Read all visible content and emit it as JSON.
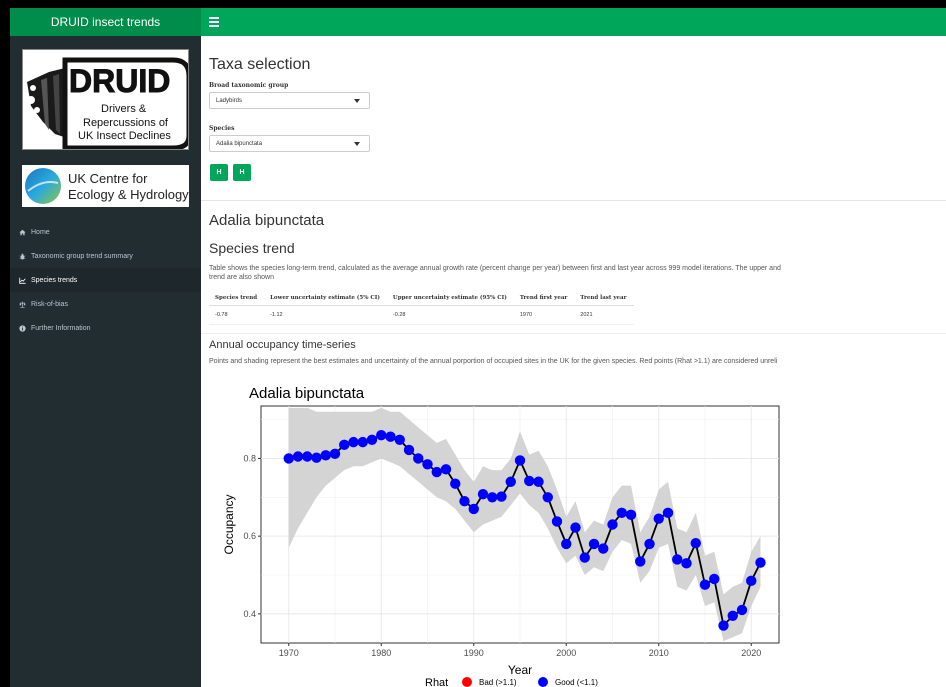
{
  "app": {
    "title": "DRUID insect trends"
  },
  "logos": {
    "druid": {
      "wordmark": "DRUID",
      "line1": "Drivers &",
      "line2": "Repercussions of",
      "line3": "UK Insect Declines"
    },
    "ukceh": {
      "line1": "UK Centre for",
      "line2": "Ecology & Hydrology"
    }
  },
  "sidebar": {
    "items": [
      {
        "label": "Home",
        "icon": "home-icon"
      },
      {
        "label": "Taxonomic group trend summary",
        "icon": "bug-icon"
      },
      {
        "label": "Species trends",
        "icon": "chart-line-icon"
      },
      {
        "label": "Risk-of-bias",
        "icon": "balance-icon"
      },
      {
        "label": "Further Information",
        "icon": "info-circle-icon"
      }
    ]
  },
  "taxa": {
    "heading": "Taxa selection",
    "group_label": "Broad taxonomic group",
    "group_value": "Ladybirds",
    "species_label": "Species",
    "species_value": "Adalia bipunctata",
    "prev_label": "H",
    "next_label": "H"
  },
  "species": {
    "title": "Adalia bipunctata",
    "trend_heading": "Species trend",
    "trend_desc_1": "Table shows the species long-term trend, calculated as the average annual growth rate (percent change per year) between first and last year across 999 model iterations. The upper and",
    "trend_desc_2": "trend are also shown",
    "table": {
      "headers": [
        "Species trend",
        "Lower uncertainty estimate (5% CI)",
        "Upper uncertainty estimate (95% CI)",
        "Trend first year",
        "Trend last year"
      ],
      "row": [
        "-0.78",
        "-1.12",
        "-0.28",
        "1970",
        "2021"
      ]
    },
    "annual_heading": "Annual occupancy time-series",
    "annual_desc": "Points and shading represent the best estimates and uncertainty of the annual porportion of occupied sites in the UK for the given species. Red points (Rhat >1.1) are considered unreli"
  },
  "chart_data": {
    "type": "line",
    "title": "Adalia bipunctata",
    "xlabel": "Year",
    "ylabel": "Occupancy",
    "xlim": [
      1967,
      2023
    ],
    "ylim": [
      0.325,
      0.935
    ],
    "xticks": [
      1970,
      1980,
      1990,
      2000,
      2010,
      2020
    ],
    "yticks": [
      0.4,
      0.6,
      0.8
    ],
    "grid": true,
    "x": [
      1970,
      1971,
      1972,
      1973,
      1974,
      1975,
      1976,
      1977,
      1978,
      1979,
      1980,
      1981,
      1982,
      1983,
      1984,
      1985,
      1986,
      1987,
      1988,
      1989,
      1990,
      1991,
      1992,
      1993,
      1994,
      1995,
      1996,
      1997,
      1998,
      1999,
      2000,
      2001,
      2002,
      2003,
      2004,
      2005,
      2006,
      2007,
      2008,
      2009,
      2010,
      2011,
      2012,
      2013,
      2014,
      2015,
      2016,
      2017,
      2018,
      2019,
      2020,
      2021
    ],
    "y": [
      0.8,
      0.805,
      0.805,
      0.802,
      0.808,
      0.812,
      0.835,
      0.842,
      0.842,
      0.848,
      0.86,
      0.856,
      0.848,
      0.822,
      0.8,
      0.785,
      0.765,
      0.772,
      0.735,
      0.69,
      0.67,
      0.708,
      0.7,
      0.702,
      0.74,
      0.795,
      0.742,
      0.74,
      0.7,
      0.638,
      0.58,
      0.622,
      0.545,
      0.58,
      0.568,
      0.63,
      0.66,
      0.655,
      0.535,
      0.58,
      0.645,
      0.66,
      0.54,
      0.53,
      0.582,
      0.475,
      0.49,
      0.37,
      0.395,
      0.41,
      0.485,
      0.532
    ],
    "lower": [
      0.57,
      0.62,
      0.66,
      0.7,
      0.73,
      0.75,
      0.77,
      0.78,
      0.78,
      0.79,
      0.8,
      0.79,
      0.78,
      0.76,
      0.74,
      0.72,
      0.7,
      0.69,
      0.67,
      0.64,
      0.61,
      0.63,
      0.64,
      0.65,
      0.68,
      0.71,
      0.68,
      0.66,
      0.62,
      0.57,
      0.53,
      0.55,
      0.5,
      0.52,
      0.51,
      0.56,
      0.59,
      0.58,
      0.48,
      0.51,
      0.57,
      0.58,
      0.47,
      0.46,
      0.5,
      0.42,
      0.43,
      0.33,
      0.34,
      0.35,
      0.42,
      0.47
    ],
    "upper": [
      0.93,
      0.93,
      0.93,
      0.92,
      0.92,
      0.92,
      0.92,
      0.92,
      0.92,
      0.92,
      0.93,
      0.92,
      0.92,
      0.9,
      0.88,
      0.86,
      0.84,
      0.85,
      0.81,
      0.77,
      0.74,
      0.78,
      0.77,
      0.77,
      0.8,
      0.87,
      0.81,
      0.82,
      0.78,
      0.72,
      0.65,
      0.69,
      0.61,
      0.64,
      0.63,
      0.7,
      0.73,
      0.73,
      0.61,
      0.65,
      0.72,
      0.74,
      0.62,
      0.61,
      0.66,
      0.55,
      0.56,
      0.45,
      0.47,
      0.48,
      0.56,
      0.6
    ],
    "legend": {
      "title": "Rhat",
      "items": [
        {
          "label": "Bad (>1.1)",
          "color": "#ff0000"
        },
        {
          "label": "Good (<1.1)",
          "color": "#0000ff"
        }
      ],
      "placement": "bottom"
    },
    "point_color": "#0000ff"
  }
}
